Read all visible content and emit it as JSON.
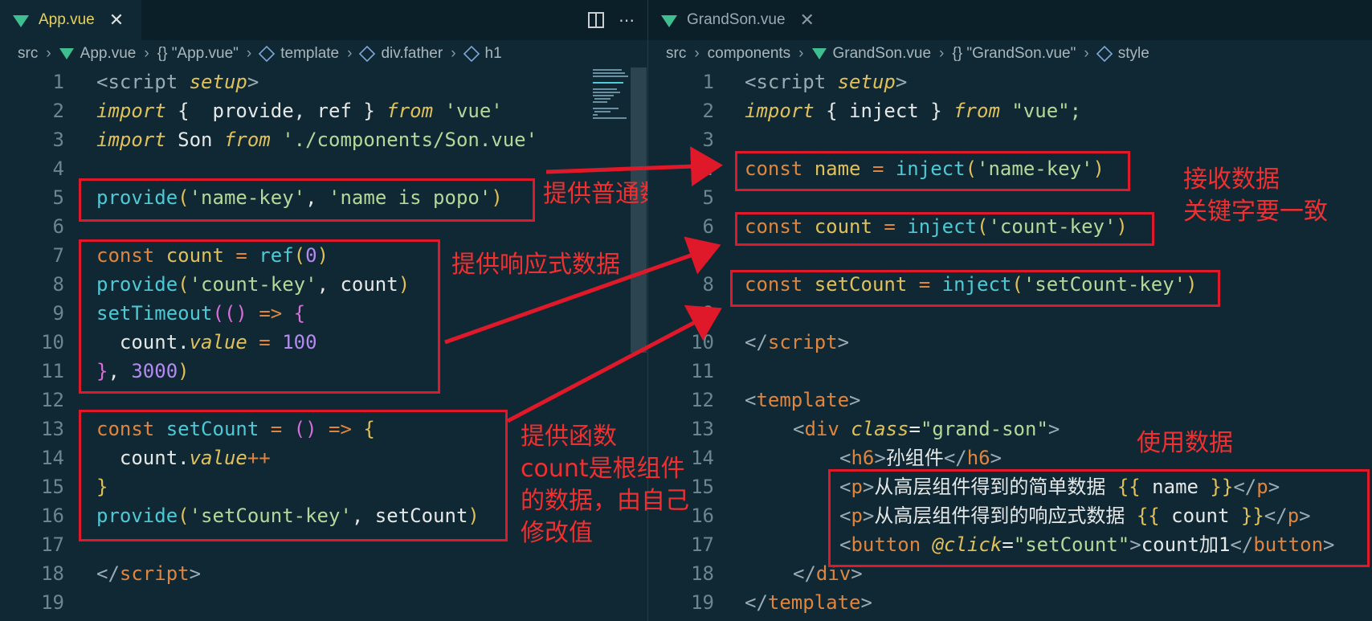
{
  "left": {
    "tab": {
      "label": "App.vue",
      "close": "✕"
    },
    "breadcrumb": [
      "src",
      "App.vue",
      "{} \"App.vue\"",
      "template",
      "div.father",
      "h1"
    ],
    "line_numbers": [
      "1",
      "2",
      "3",
      "4",
      "5",
      "6",
      "7",
      "8",
      "9",
      "10",
      "11",
      "12",
      "13",
      "14",
      "15",
      "16",
      "17",
      "18",
      "19"
    ],
    "code": {
      "l1a": "<script ",
      "l1b": "setup",
      "l1c": ">",
      "l2a": "import",
      "l2b": " {  provide, ref } ",
      "l2c": "from",
      "l2d": " 'vue'",
      "l3a": "import",
      "l3b": " Son ",
      "l3c": "from",
      "l3d": " './components/Son.vue'",
      "l5a": "provide",
      "l5b": "(",
      "l5c": "'name-key'",
      "l5d": ", ",
      "l5e": "'name is popo'",
      "l5f": ")",
      "l7a": "const",
      "l7b": " count ",
      "l7c": "=",
      "l7d": " ref",
      "l7e": "(",
      "l7f": "0",
      "l7g": ")",
      "l8a": "provide",
      "l8b": "(",
      "l8c": "'count-key'",
      "l8d": ", count",
      "l8e": ")",
      "l9a": "setTimeout",
      "l9b": "((",
      "l9c": ") ",
      "l9d": "=>",
      "l9e": " {",
      "l10a": "  count.",
      "l10b": "value",
      "l10c": " = ",
      "l10d": "100",
      "l11a": "}",
      "l11b": ", ",
      "l11c": "3000",
      "l11d": ")",
      "l13a": "const",
      "l13b": " setCount ",
      "l13c": "=",
      "l13d": " () ",
      "l13e": "=>",
      "l13f": " {",
      "l14a": "  count.",
      "l14b": "value",
      "l14c": "++",
      "l15a": "}",
      "l16a": "provide",
      "l16b": "(",
      "l16c": "'setCount-key'",
      "l16d": ", setCount",
      "l16e": ")",
      "l18a": "</",
      "l18b": "script",
      "l18c": ">"
    },
    "annotations": {
      "plain": "提供普通数据",
      "reactive": "提供响应式数据",
      "fn": "提供函数\ncount是根组件\n的数据，由自己\n修改值"
    }
  },
  "right": {
    "tab": {
      "label": "GrandSon.vue",
      "close": "✕"
    },
    "breadcrumb": [
      "src",
      "components",
      "GrandSon.vue",
      "{} \"GrandSon.vue\"",
      "style"
    ],
    "line_numbers": [
      "1",
      "2",
      "3",
      "4",
      "5",
      "6",
      "7",
      "8",
      "9",
      "10",
      "11",
      "12",
      "13",
      "14",
      "15",
      "16",
      "17",
      "18",
      "19"
    ],
    "code": {
      "r1a": "<script ",
      "r1b": "setup",
      "r1c": ">",
      "r2a": "import",
      "r2b": " { inject } ",
      "r2c": "from",
      "r2d": " \"vue\";",
      "r4a": "const",
      "r4b": " name ",
      "r4c": "=",
      "r4d": " inject",
      "r4e": "(",
      "r4f": "'name-key'",
      "r4g": ")",
      "r6a": "const",
      "r6b": " count ",
      "r6c": "=",
      "r6d": " inject",
      "r6e": "(",
      "r6f": "'count-key'",
      "r6g": ")",
      "r8a": "const",
      "r8b": " setCount ",
      "r8c": "=",
      "r8d": " inject",
      "r8e": "(",
      "r8f": "'setCount-key'",
      "r8g": ")",
      "r10a": "</",
      "r10b": "script",
      "r10c": ">",
      "r12a": "<",
      "r12b": "template",
      "r12c": ">",
      "r13a": "<",
      "r13b": "div ",
      "r13c": "class",
      "r13d": "=",
      "r13e": "\"grand-son\"",
      "r13f": ">",
      "r14a": "<",
      "r14b": "h6",
      "r14c": ">",
      "r14d": "孙组件",
      "r14e": "</",
      "r14f": "h6",
      "r14g": ">",
      "r15a": "<",
      "r15b": "p",
      "r15c": ">",
      "r15d": "从高层组件得到的简单数据 ",
      "r15e": "{{",
      "r15f": " name ",
      "r15g": "}}",
      "r15h": "</",
      "r15i": "p",
      "r15j": ">",
      "r16a": "<",
      "r16b": "p",
      "r16c": ">",
      "r16d": "从高层组件得到的响应式数据 ",
      "r16e": "{{",
      "r16f": " count ",
      "r16g": "}}",
      "r16h": "</",
      "r16i": "p",
      "r16j": ">",
      "r17a": "<",
      "r17b": "button ",
      "r17c": "@click",
      "r17d": "=",
      "r17e": "\"setCount\"",
      "r17f": ">",
      "r17g": "count加1",
      "r17h": "</",
      "r17i": "button",
      "r17j": ">",
      "r18a": "</",
      "r18b": "div",
      "r18c": ">",
      "r19a": "</",
      "r19b": "template",
      "r19c": ">"
    },
    "annotations": {
      "receive": "接收数据\n关键字要一致",
      "use": "使用数据"
    }
  },
  "colors": {
    "annotation": "#e0192a",
    "background": "#0f2833",
    "accent_tab": "#e8d25a",
    "vue_icon": "#3fbf8f"
  }
}
